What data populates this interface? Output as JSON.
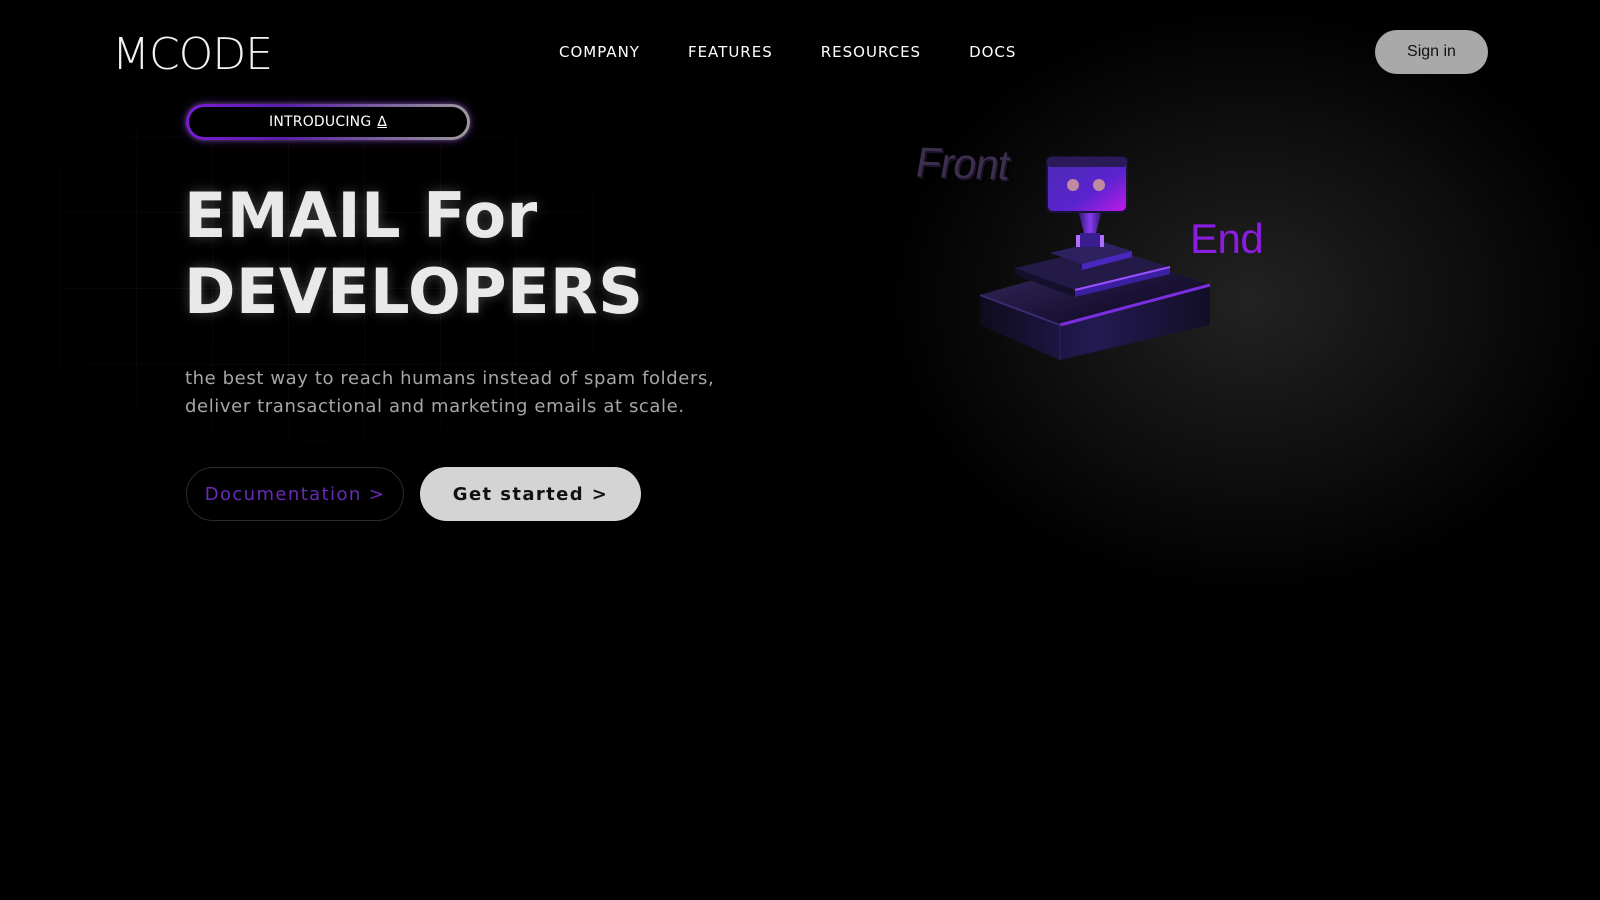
{
  "header": {
    "logo": "MCODE",
    "nav": [
      "COMPANY",
      "FEATURES",
      "RESOURCES",
      "DOCS"
    ],
    "signin_label": "Sign in"
  },
  "hero": {
    "intro_label": "INTRODUCING",
    "intro_glyph": "∆",
    "title_line1": "EMAIL For",
    "title_line2": "DEVELOPERS",
    "subtitle_line1": "the best way to reach humans instead of spam folders,",
    "subtitle_line2": "deliver transactional and marketing emails at scale.",
    "docs_button": "Documentation  >",
    "start_button": "Get started  >"
  },
  "illustration": {
    "word_left": "Front",
    "word_right": "End",
    "accent_color": "#8c1ce0",
    "icon": "robot-on-pedestal-icon"
  }
}
